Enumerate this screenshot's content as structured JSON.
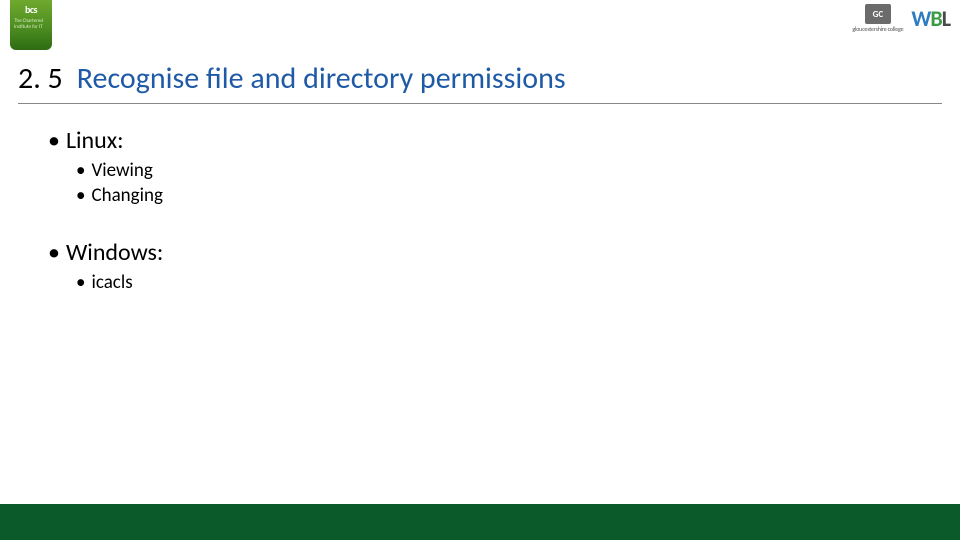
{
  "logos": {
    "bcs": {
      "label": "bcs",
      "sub": "The Chartered Institute for IT"
    },
    "gc": {
      "label": "GC",
      "sub": "gloucestershire college"
    },
    "wbl": {
      "w": "W",
      "b": "B",
      "l": "L"
    }
  },
  "title": {
    "number": "2. 5",
    "text": "Recognise file and directory permissions"
  },
  "content": {
    "section1": {
      "heading": "Linux:",
      "items": [
        "Viewing",
        "Changing"
      ]
    },
    "section2": {
      "heading": "Windows:",
      "items": [
        "icacls"
      ]
    }
  },
  "colors": {
    "title": "#1f5aa6",
    "footer": "#0b5a2a",
    "bcs": "#4a8a1f"
  }
}
